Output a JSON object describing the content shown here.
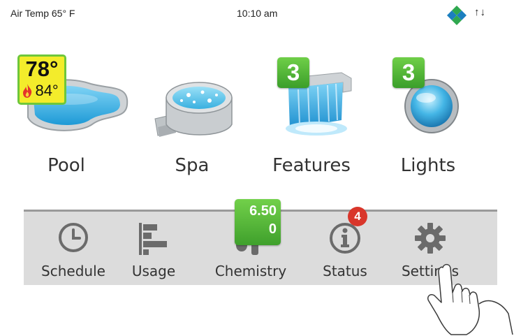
{
  "status_bar": {
    "air_temp": "Air Temp 65° F",
    "time": "10:10 am",
    "connection_arrows": "↑↓"
  },
  "tiles": {
    "pool": {
      "label": "Pool",
      "set_temp": "78°",
      "actual_temp": "84°",
      "heating": true
    },
    "spa": {
      "label": "Spa"
    },
    "features": {
      "label": "Features",
      "count": "3"
    },
    "lights": {
      "label": "Lights",
      "count": "3"
    }
  },
  "nav": {
    "schedule": {
      "label": "Schedule",
      "icon": "clock-icon"
    },
    "usage": {
      "label": "Usage",
      "icon": "bar-chart-icon"
    },
    "chemistry": {
      "label": "Chemistry",
      "icon": "water-drop-thermometer-icon",
      "ph": "6.50",
      "orp": "0"
    },
    "status": {
      "label": "Status",
      "icon": "info-icon",
      "alerts": "4"
    },
    "settings": {
      "label": "Settings",
      "icon": "gear-icon"
    }
  },
  "colors": {
    "badge_green": "#4cb832",
    "temp_badge_yellow": "#f3ec2b",
    "alert_red": "#d9362b",
    "nav_bg": "#dcdcdc",
    "icon_gray": "#6b6b6b"
  }
}
